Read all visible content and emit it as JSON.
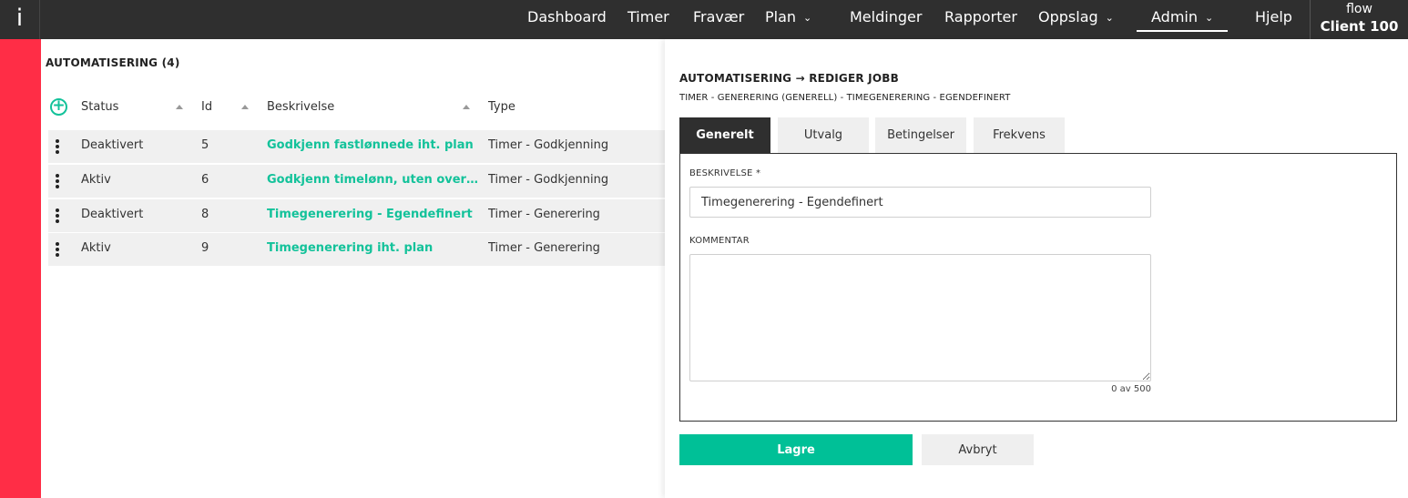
{
  "app": {
    "logo": "i",
    "client_small": "flow",
    "client_name": "Client 100"
  },
  "nav": {
    "dashboard": "Dashboard",
    "timer": "Timer",
    "fravaer": "Fravær",
    "plan": "Plan",
    "meldinger": "Meldinger",
    "rapporter": "Rapporter",
    "oppslag": "Oppslag",
    "admin": "Admin",
    "hjelp": "Hjelp"
  },
  "list": {
    "title": "AUTOMATISERING (4)",
    "columns": {
      "status": "Status",
      "id": "Id",
      "beskrivelse": "Beskrivelse",
      "type": "Type"
    },
    "rows": [
      {
        "status": "Deaktivert",
        "id": "5",
        "beskrivelse": "Godkjenn fastlønnede iht. plan",
        "type": "Timer - Godkjenning"
      },
      {
        "status": "Aktiv",
        "id": "6",
        "beskrivelse": "Godkjenn timelønn, uten overtid el...",
        "type": "Timer - Godkjenning"
      },
      {
        "status": "Deaktivert",
        "id": "8",
        "beskrivelse": "Timegenerering - Egendefinert",
        "type": "Timer - Generering"
      },
      {
        "status": "Aktiv",
        "id": "9",
        "beskrivelse": "Timegenerering iht. plan",
        "type": "Timer - Generering"
      }
    ]
  },
  "editor": {
    "title": "AUTOMATISERING → REDIGER JOBB",
    "subtitle": "TIMER - GENERERING (GENERELL) - TIMEGENERERING - EGENDEFINERT",
    "tabs": {
      "generelt": "Generelt",
      "utvalg": "Utvalg",
      "betingelser": "Betingelser",
      "frekvens": "Frekvens"
    },
    "beskrivelse_label": "BESKRIVELSE *",
    "beskrivelse_value": "Timegenerering - Egendefinert",
    "kommentar_label": "KOMMENTAR",
    "kommentar_value": "",
    "counter": "0 av 500",
    "save_label": "Lagre",
    "cancel_label": "Avbryt"
  },
  "colors": {
    "accent": "#00c097",
    "rail": "#ff2d46",
    "topbar": "#2f2f2f"
  }
}
